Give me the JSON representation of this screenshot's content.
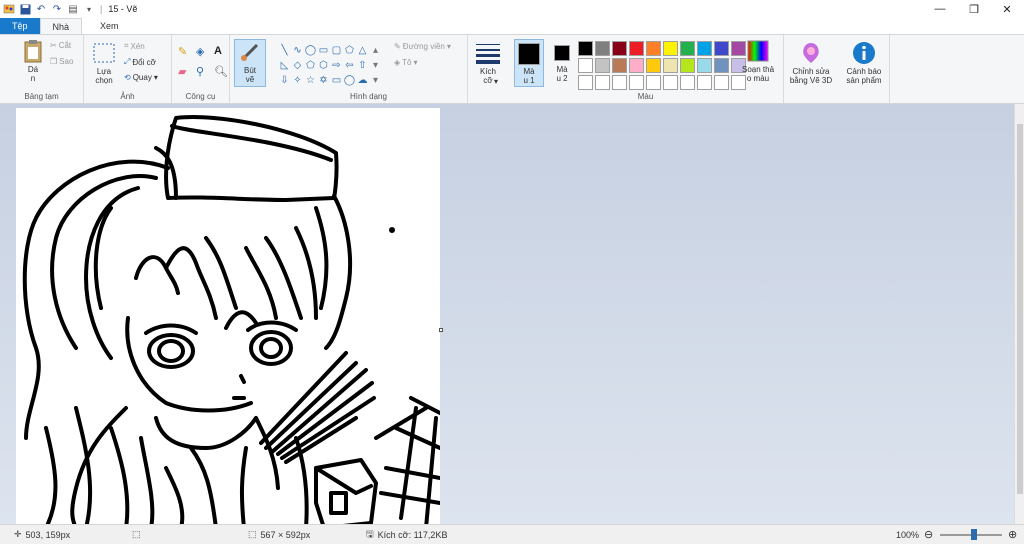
{
  "titlebar": {
    "title": "15 - Vẽ",
    "qat_separator": "|"
  },
  "tabs": {
    "file": "Tệp",
    "home": "Nhà",
    "view": "Xem"
  },
  "clipboard": {
    "paste": "Dá\nn",
    "cut": "Cắt",
    "copy": "Sao",
    "group": "Bảng tạm"
  },
  "image": {
    "select": "Lựa\nchọn",
    "crop": "Xén",
    "resize": "Đổi cỡ",
    "rotate": "Quay",
    "group": "Ảnh"
  },
  "tools": {
    "group": "Công cụ"
  },
  "brush": {
    "label": "Bút\nvẽ"
  },
  "shapes": {
    "outline": "Đường viền",
    "fill": "Tô",
    "group": "Hình dạng"
  },
  "size": {
    "label": "Kích\ncỡ"
  },
  "colors": {
    "color1": "Mà\nu 1",
    "color2": "Mà\nu 2",
    "edit": "Soạn thả\no màu",
    "group": "Màu",
    "color1_value": "#000000",
    "color2_value": "#000000",
    "row1": [
      "#000000",
      "#7f7f7f",
      "#880015",
      "#ed1c24",
      "#ff7f27",
      "#fff200",
      "#22b14c",
      "#00a2e8",
      "#3f48cc",
      "#a349a4"
    ],
    "row2": [
      "#ffffff",
      "#c3c3c3",
      "#b97a57",
      "#ffaec9",
      "#ffc90e",
      "#efe4b0",
      "#b5e61d",
      "#99d9ea",
      "#7092be",
      "#c8bfe7"
    ],
    "row3": [
      "#ffffff",
      "#ffffff",
      "#ffffff",
      "#ffffff",
      "#ffffff",
      "#ffffff",
      "#ffffff",
      "#ffffff",
      "#ffffff",
      "#ffffff"
    ]
  },
  "paint3d": {
    "label": "Chỉnh sửa\nbằng Vẽ 3D"
  },
  "alert": {
    "label": "Cảnh báo\nsản phẩm"
  },
  "status": {
    "cursor": "503, 159px",
    "dimensions": "567 × 592px",
    "filesize": "Kích cỡ: 117,2KB",
    "zoom": "100%"
  }
}
